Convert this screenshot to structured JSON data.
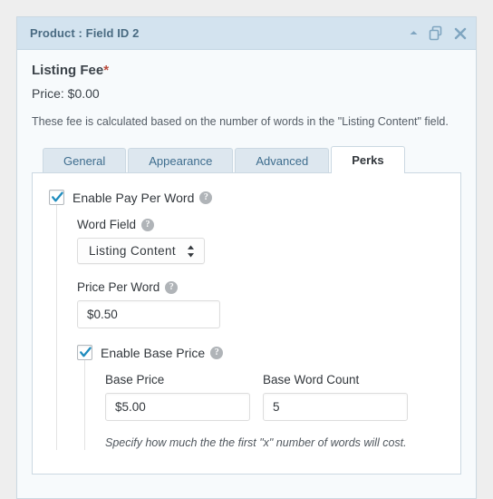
{
  "panel": {
    "title": "Product : Field ID 2",
    "header_icons": [
      {
        "name": "collapse-caret-icon",
        "label": "Collapse"
      },
      {
        "name": "duplicate-icon",
        "label": "Duplicate"
      },
      {
        "name": "close-icon",
        "label": "Close"
      }
    ]
  },
  "fee": {
    "title": "Listing Fee",
    "required_marker": "*",
    "price_line": "Price: $0.00",
    "description": "These fee is calculated based on the number of words in the \"Listing Content\" field."
  },
  "tabs": [
    {
      "label": "General",
      "active": false
    },
    {
      "label": "Appearance",
      "active": false
    },
    {
      "label": "Advanced",
      "active": false
    },
    {
      "label": "Perks",
      "active": true
    }
  ],
  "form": {
    "enable_pay_per_word": {
      "label": "Enable Pay Per Word",
      "checked": true,
      "help": "?"
    },
    "word_field": {
      "label": "Word Field",
      "help": "?",
      "value": "Listing Content",
      "options": [
        "Listing Content"
      ]
    },
    "price_per_word": {
      "label": "Price Per Word",
      "help": "?",
      "value": "$0.50"
    },
    "enable_base_price": {
      "label": "Enable Base Price",
      "checked": true,
      "help": "?"
    },
    "base_price": {
      "label": "Base Price",
      "value": "$5.00"
    },
    "base_word_count": {
      "label": "Base Word Count",
      "value": "5"
    },
    "hint": "Specify how much the the first \"x\" number of words will cost."
  },
  "colors": {
    "header_bg": "#d3e3ef",
    "header_text": "#4a6b82",
    "panel_border": "#cbd8e2",
    "panel_bg": "#f7fafc",
    "page_bg": "#eeeeee",
    "tab_inactive_bg": "#dde7ef",
    "tab_link": "#3e6d8e",
    "required": "#b94a3c",
    "checkbox_check": "#1e8cbe",
    "help_bg": "#b0b4b8"
  }
}
